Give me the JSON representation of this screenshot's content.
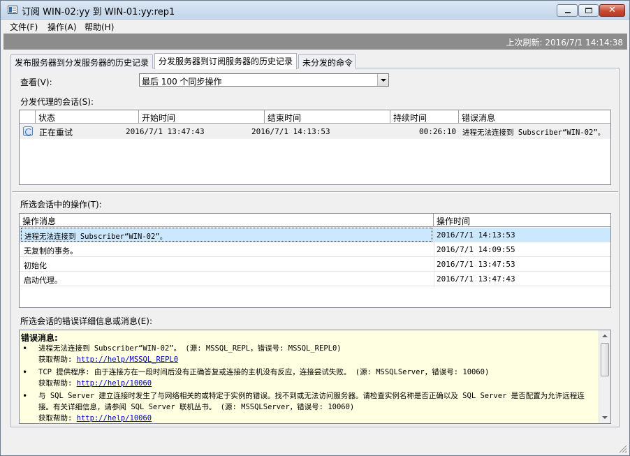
{
  "window": {
    "title": "订阅 WIN-02:yy 到 WIN-01:yy:rep1",
    "min_label": "",
    "max_label": "",
    "close_label": "✕"
  },
  "menu": [
    "文件(F)",
    "操作(A)",
    "帮助(H)"
  ],
  "refresh": "上次刷新: 2016/7/1 14:14:38",
  "tabs": [
    "发布服务器到分发服务器的历史记录",
    "分发服务器到订阅服务器的历史记录",
    "未分发的命令"
  ],
  "view": {
    "label": "查看(V):",
    "selected": "最后 100 个同步操作"
  },
  "sessions": {
    "label": "分发代理的会话(S):",
    "columns": [
      "状态",
      "开始时间",
      "结束时间",
      "持续时间",
      "错误消息"
    ],
    "rows": [
      {
        "status": "正在重试",
        "start": "2016/7/1 13:47:43",
        "end": "2016/7/1 14:13:53",
        "duration": "00:26:10",
        "error": "进程无法连接到 Subscriber“WIN-02”。"
      }
    ]
  },
  "actions": {
    "label": "所选会话中的操作(T):",
    "columns": [
      "操作消息",
      "操作时间"
    ],
    "rows": [
      {
        "message": "进程无法连接到 Subscriber“WIN-02”。",
        "time": "2016/7/1 14:13:53"
      },
      {
        "message": "无复制的事务。",
        "time": "2016/7/1 14:09:55"
      },
      {
        "message": "初始化",
        "time": "2016/7/1 13:47:53"
      },
      {
        "message": "启动代理。",
        "time": "2016/7/1 13:47:43"
      }
    ]
  },
  "details": {
    "label": "所选会话的错误详细信息或消息(E):",
    "title": "错误消息:",
    "items": [
      {
        "text": "进程无法连接到 Subscriber“WIN-02”。 (源: MSSQL_REPL，错误号: MSSQL_REPL0)",
        "help_label": "获取帮助:",
        "help_link": "http://help/MSSQL_REPL0"
      },
      {
        "text": "TCP 提供程序: 由于连接方在一段时间后没有正确答复或连接的主机没有反应，连接尝试失败。 (源: MSSQLServer，错误号: 10060)",
        "help_label": "获取帮助:",
        "help_link": "http://help/10060"
      },
      {
        "text": "与 SQL Server 建立连接时发生了与网络相关的或特定于实例的错误。找不到或无法访问服务器。请检查实例名称是否正确以及 SQL Server 是否配置为允许远程连接。有关详细信息，请参阅 SQL Server 联机丛书。 (源: MSSQLServer，错误号: 10060)",
        "help_label": "获取帮助:",
        "help_link": "http://help/10060"
      }
    ]
  },
  "colors": {
    "selected_row": "#cce8ff",
    "details_bg": "#ffffe1",
    "link": "#0000cc"
  }
}
